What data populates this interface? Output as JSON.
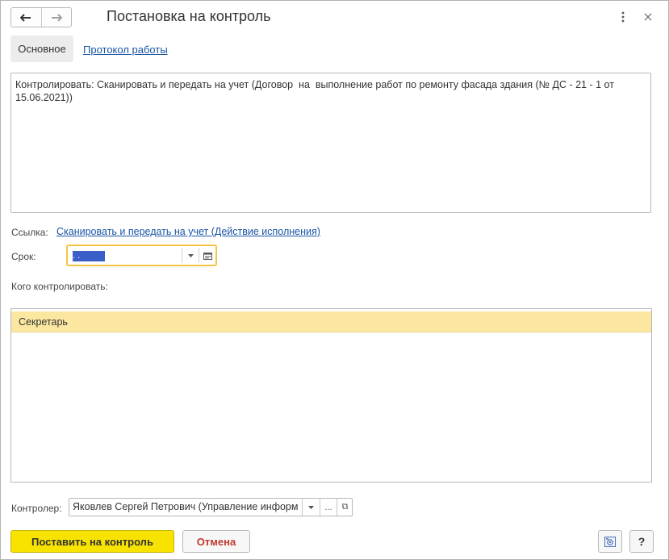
{
  "window": {
    "title": "Постановка на контроль"
  },
  "tabs": {
    "main_label": "Основное",
    "protocol_label": "Протокол работы"
  },
  "description": {
    "text": "Контролировать: Сканировать и передать на учет (Договор  на  выполнение работ по ремонту фасада здания (№ ДС - 21 - 1 от 15.06.2021))"
  },
  "link_field": {
    "label": "Ссылка:",
    "value": "Сканировать и передать на учет (Действие исполнения)"
  },
  "deadline": {
    "label": "Срок:",
    "value": " .  ."
  },
  "whom": {
    "label": "Кого контролировать:",
    "rows": [
      "Секретарь"
    ]
  },
  "controller": {
    "label": "Контролер:",
    "value": "Яковлев Сергей Петрович (Управление информ",
    "select_glyph": "...",
    "open_glyph": "⧉"
  },
  "buttons": {
    "submit": "Поставить на контроль",
    "cancel": "Отмена",
    "help": "?"
  },
  "colors": {
    "accent_yellow": "#f7e200",
    "focus_border": "#f5c542",
    "selection_row": "#fbe7a0",
    "link": "#1a55a5",
    "cancel_text": "#c0392b"
  },
  "icons": {
    "back": "arrow-left-icon",
    "forward": "arrow-right-icon",
    "more": "kebab-icon",
    "close": "close-icon",
    "dropdown": "chevron-down-icon",
    "calendar": "calendar-icon",
    "screenshot": "camera-icon"
  }
}
